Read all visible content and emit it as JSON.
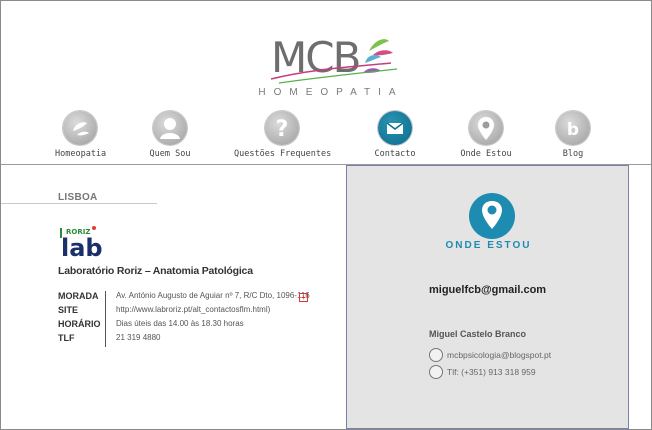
{
  "logo": {
    "text": "MCB",
    "subtitle": "HOMEOPATIA"
  },
  "nav": [
    {
      "label": "Homeopatia",
      "icon": "leaves-icon"
    },
    {
      "label": "Quem Sou",
      "icon": "user-icon"
    },
    {
      "label": "Questões Frequentes",
      "icon": "question-icon"
    },
    {
      "label": "Contacto",
      "icon": "envelope-icon"
    },
    {
      "label": "Onde Estou",
      "icon": "location-pin-icon"
    },
    {
      "label": "Blog",
      "icon": "blogger-icon"
    }
  ],
  "left": {
    "city": "LISBOA",
    "lab_logo": {
      "small": "RORIZ",
      "big": "lab"
    },
    "lab_title": "Laboratório Roriz – Anatomia Patológica",
    "info_keys": [
      "MORADA",
      "SITE",
      "HORÁRIO",
      "TLF"
    ],
    "info_values": [
      "Av. António Augusto de Aguiar nº 7, R/C Dto, 1096-116",
      "http://www.labroriz.pt/alt_contactosflm.html)",
      "Dias úteis das 14.00 às 18.30 horas",
      "21 319 4880"
    ]
  },
  "right": {
    "title": "ONDE ESTOU",
    "email": "miguelfcb@gmail.com",
    "person": "Miguel Castelo Branco",
    "blog": "mcbpsicologia@blogspot.pt",
    "phone": "Tlf: (+351) 913 318 959"
  },
  "colors": {
    "accent": "#1e8bb0",
    "panel_bg": "#e4e4e4"
  }
}
